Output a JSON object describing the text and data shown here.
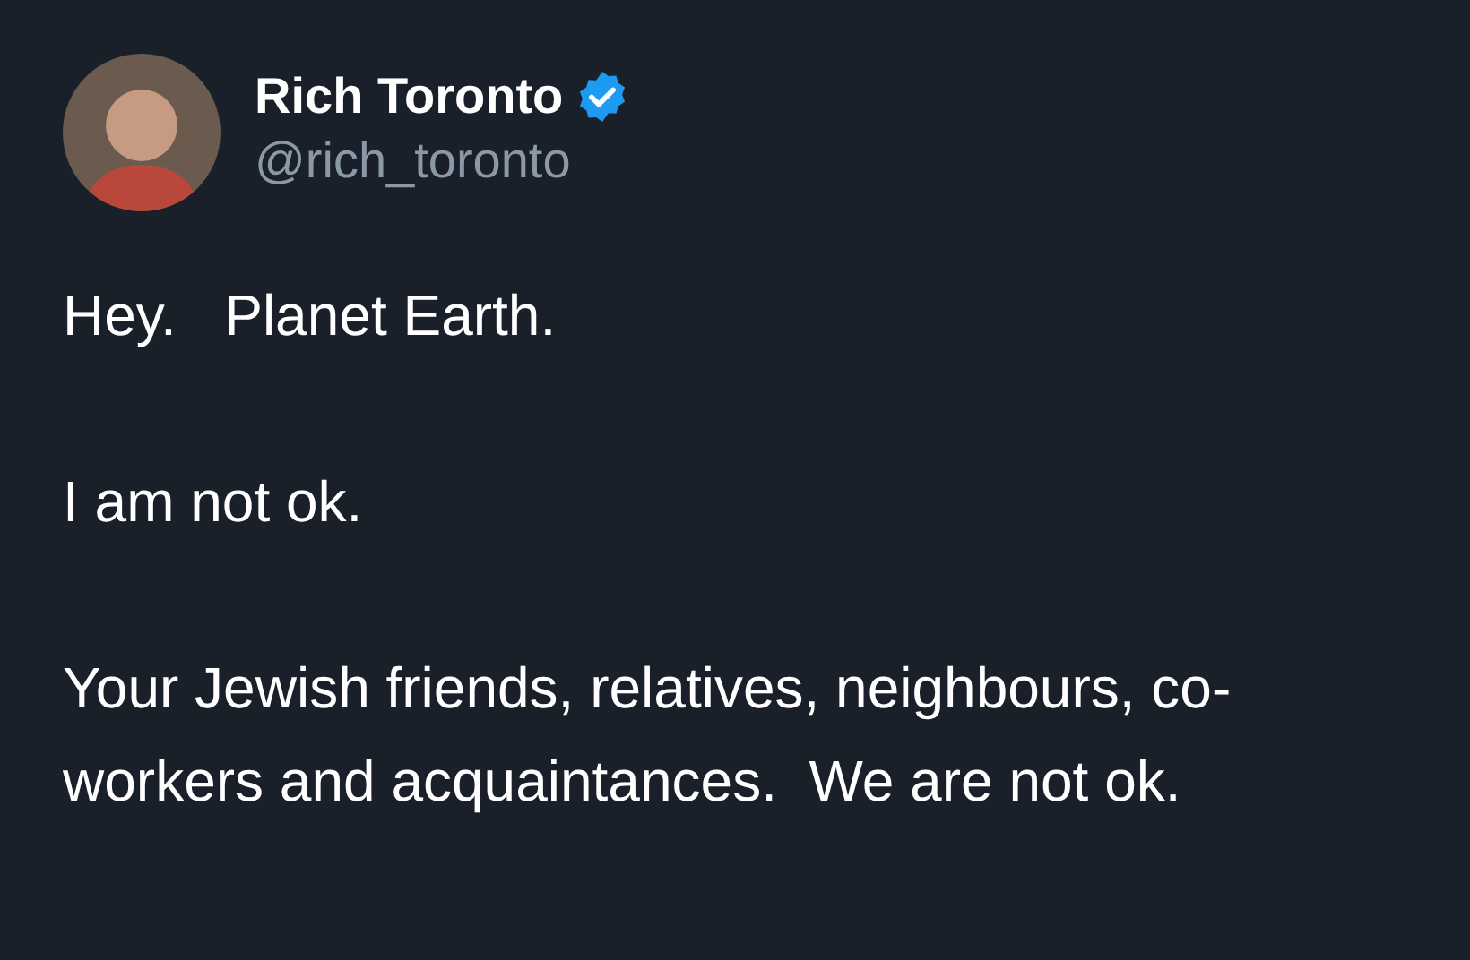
{
  "author": {
    "name": "Rich Toronto",
    "verified": true,
    "handle": "@rich_toronto"
  },
  "paragraphs": [
    "Hey.   Planet Earth.",
    "I am not ok.",
    "Your Jewish friends, relatives, neighbours, co-workers and acquaintances.  We are not ok."
  ]
}
